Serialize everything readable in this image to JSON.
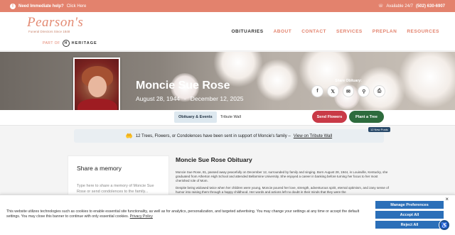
{
  "topbar": {
    "help_icon": "warning-icon",
    "help_bold": "Need Immediate help?",
    "help_link": "Click Here",
    "available": "Available 24/7",
    "phone": "(502) 630-6907"
  },
  "logo": {
    "name": "Pearson's",
    "tagline": "Funeral Directors Since 1848",
    "part_of": "PART OF",
    "heritage": "HERITAGE"
  },
  "nav": {
    "items": [
      "OBITUARIES",
      "ABOUT",
      "CONTACT",
      "SERVICES",
      "PREPLAN",
      "RESOURCES"
    ]
  },
  "person": {
    "name": "Moncie Sue Rose",
    "born": "August 28, 1944",
    "sep": "-",
    "died": "December 12, 2025"
  },
  "share": {
    "label": "Share Obituary:",
    "icons": [
      "facebook-icon",
      "x-icon",
      "email-icon",
      "link-icon",
      "print-icon"
    ],
    "glyphs": [
      "f",
      "𝕏",
      "✉",
      "⚲",
      "⎙"
    ]
  },
  "tabs": {
    "obituary_events": "Obituary & Events",
    "tribute_wall": "Tribute Wall"
  },
  "actions": {
    "send_flowers": "Send Flowers",
    "plant_tree": "Plant a Tree"
  },
  "support": {
    "text": "12 Trees, Flowers, or Condolences have been sent in support of Moncie's family –",
    "link": "View on Tribute Wall",
    "badge": "12 New Posts"
  },
  "memory": {
    "title": "Share a memory",
    "placeholder": "Type here to share a memory of Moncie Sue Rose or send condolences to the family..."
  },
  "obituary": {
    "title": "Moncie Sue Rose Obituary",
    "p1": "Moncie Sue Rose, 81, passed away peacefully on December 12, surrounded by family and singing. Born August 28, 1944, in Louisville, Kentucky, she graduated from Atherton High School and attended Bellarmine University. She enjoyed a career in banking before turning her focus to her most cherished role of Mom.",
    "p2": "Despite being widowed twice when her children were young, Moncie poured her love, strength, adventurous spirit, eternal optimism, and zany sense of humor into raising them through a happy childhood. Her words and actions left no doubt in their minds that they were the"
  },
  "cookie": {
    "text": "This website utilizes technologies such as cookies to enable essential site functionality, as well as for analytics, personalization, and targeted advertising. You may change your settings at any time or accept the default settings. You may close this banner to continue with only essential cookies.",
    "policy": "Privacy Policy",
    "manage": "Manage Preferences",
    "accept": "Accept All",
    "reject": "Reject All",
    "close": "×"
  },
  "colors": {
    "accent": "#e3826d",
    "flowers": "#c93a47",
    "tree": "#2e6b3d",
    "cookie_btn": "#2b6fb8"
  }
}
